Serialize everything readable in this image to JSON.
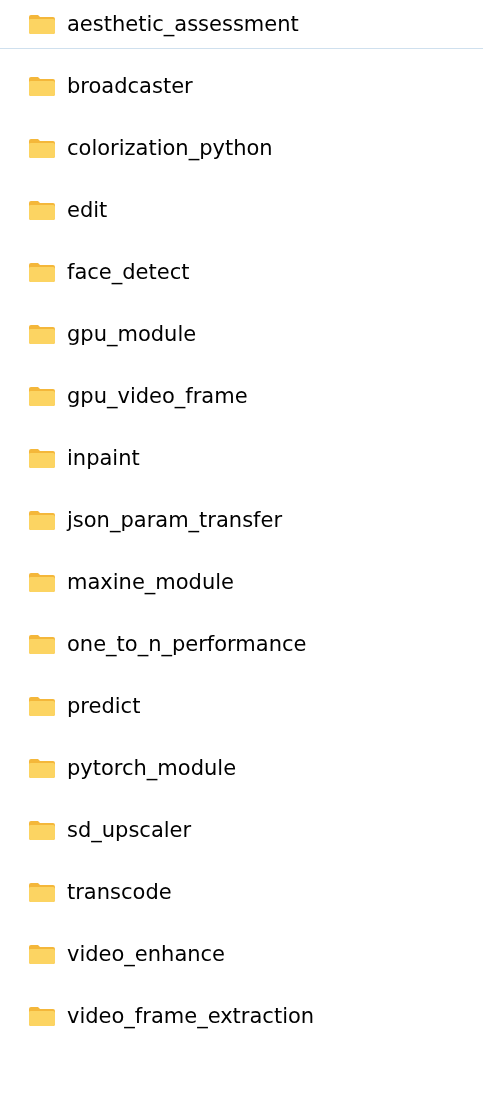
{
  "header_item": {
    "name": "aesthetic_assessment"
  },
  "folders": [
    {
      "name": "broadcaster"
    },
    {
      "name": "colorization_python"
    },
    {
      "name": "edit"
    },
    {
      "name": "face_detect"
    },
    {
      "name": "gpu_module"
    },
    {
      "name": "gpu_video_frame"
    },
    {
      "name": "inpaint"
    },
    {
      "name": "json_param_transfer"
    },
    {
      "name": "maxine_module"
    },
    {
      "name": "one_to_n_performance"
    },
    {
      "name": "predict"
    },
    {
      "name": "pytorch_module"
    },
    {
      "name": "sd_upscaler"
    },
    {
      "name": "transcode"
    },
    {
      "name": "video_enhance"
    },
    {
      "name": "video_frame_extraction"
    }
  ]
}
